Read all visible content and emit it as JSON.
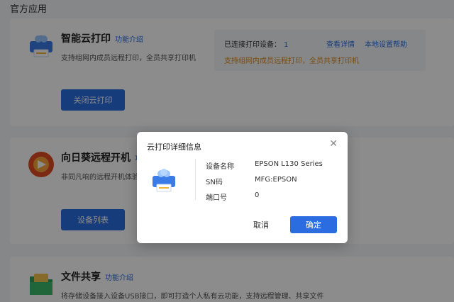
{
  "section_title": "官方应用",
  "apps": [
    {
      "name": "智能云打印",
      "link": "功能介绍",
      "desc": "支持组网内成员远程打印，全员共享打印机",
      "button": "关闭云打印",
      "icon": "printer-cloud-icon"
    },
    {
      "name": "向日葵远程开机",
      "link": "功",
      "desc": "非同凡响的远程开机体验",
      "button": "设备列表",
      "icon": "sunflower-remote-icon"
    },
    {
      "name": "文件共享",
      "link": "功能介绍",
      "desc": "将存储设备接入设备USB接口，即可打造个人私有云功能，支持远程管理、共享文件",
      "button": "",
      "icon": "folder-share-icon"
    }
  ],
  "status": {
    "connected_label": "已连接打印设备：",
    "connected_count": "1",
    "view_details": "查看详情",
    "local_help": "本地设置帮助",
    "notice": "支持组网内成员远程打印，全员共享打印机"
  },
  "modal": {
    "title": "云打印详细信息",
    "rows": [
      {
        "label": "设备名称",
        "value": "EPSON L130 Series"
      },
      {
        "label": "SN码",
        "value": "MFG:EPSON"
      },
      {
        "label": "端口号",
        "value": "0"
      }
    ],
    "cancel": "取消",
    "ok": "确定"
  },
  "colors": {
    "accent": "#2b6de0",
    "warning": "#e08a1a",
    "overlay": "rgba(0,0,0,0.45)"
  }
}
